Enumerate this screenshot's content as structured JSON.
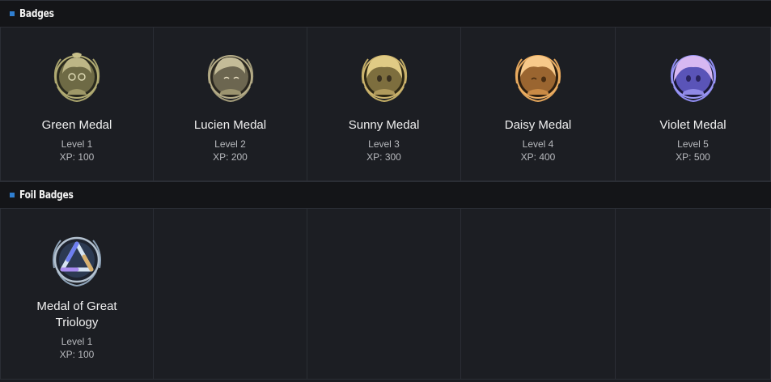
{
  "sections": [
    {
      "title": "Badges"
    },
    {
      "title": "Foil Badges"
    }
  ],
  "badges": [
    {
      "name": "Green Medal",
      "level": "Level 1",
      "xp": "XP: 100",
      "color": "#8b8a5a",
      "icon": "green-medal-icon"
    },
    {
      "name": "Lucien Medal",
      "level": "Level 2",
      "xp": "XP: 200",
      "color": "#8e8864",
      "icon": "lucien-medal-icon"
    },
    {
      "name": "Sunny Medal",
      "level": "Level 3",
      "xp": "XP: 300",
      "color": "#b7a45c",
      "icon": "sunny-medal-icon"
    },
    {
      "name": "Daisy Medal",
      "level": "Level 4",
      "xp": "XP: 400",
      "color": "#d99a4e",
      "icon": "daisy-medal-icon"
    },
    {
      "name": "Violet Medal",
      "level": "Level 5",
      "xp": "XP: 500",
      "color": "#7d78e0",
      "icon": "violet-medal-icon"
    }
  ],
  "foil_badges": [
    {
      "name": "Medal of Great Triology",
      "level": "Level 1",
      "xp": "XP: 100",
      "icon": "great-triology-medal-icon"
    }
  ]
}
